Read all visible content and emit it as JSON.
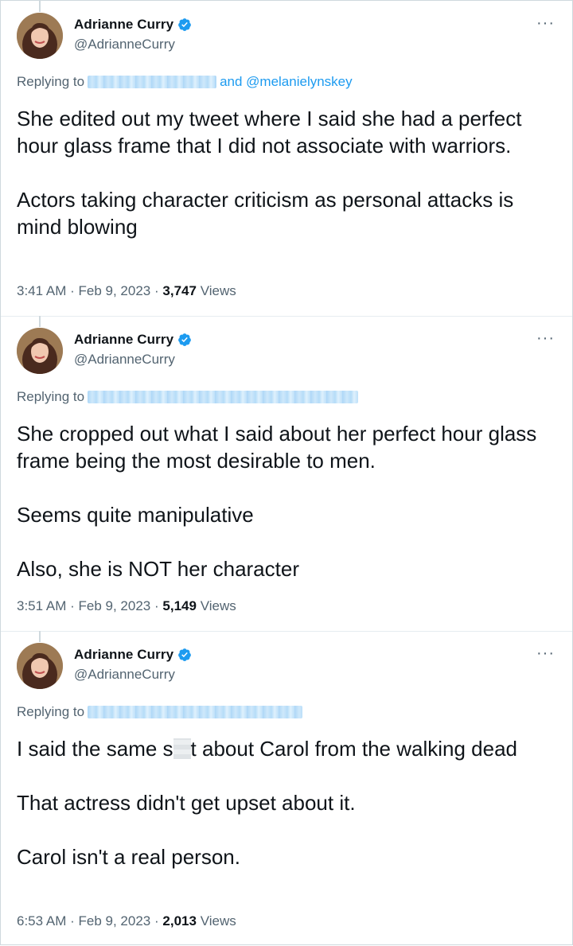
{
  "tweets": [
    {
      "name": "Adrianne Curry",
      "handle": "@AdrianneCurry",
      "more": "···",
      "replying_prefix": "Replying to",
      "replying_mention": "and @melanielynskey",
      "body": [
        "She edited out my tweet where I said she had a perfect hour glass frame that I did not associate with warriors.",
        "Actors taking character criticism as personal attacks is mind blowing"
      ],
      "time": "3:41 AM",
      "date": "Feb 9, 2023",
      "views_count": "3,747",
      "views_label": "Views"
    },
    {
      "name": "Adrianne Curry",
      "handle": "@AdrianneCurry",
      "more": "···",
      "replying_prefix": "Replying to",
      "body": [
        "She cropped out what I said about her perfect hour glass frame being the most desirable to men.",
        "Seems quite manipulative",
        "Also, she is NOT her character"
      ],
      "time": "3:51 AM",
      "date": "Feb 9, 2023",
      "views_count": "5,149",
      "views_label": "Views"
    },
    {
      "name": "Adrianne Curry",
      "handle": "@AdrianneCurry",
      "more": "···",
      "replying_prefix": "Replying to",
      "body_line1_a": "I said the same s",
      "body_line1_b": "t about Carol from the walking dead",
      "body": [
        "That actress didn't get upset about it.",
        "Carol isn't a real person."
      ],
      "time": "6:53 AM",
      "date": "Feb 9, 2023",
      "views_count": "2,013",
      "views_label": "Views"
    }
  ],
  "separator": "·",
  "colors": {
    "accent": "#1d9bf0",
    "secondary_text": "#536471",
    "primary_text": "#0f1419",
    "border": "#cfd9de"
  },
  "icons": {
    "verified": "verified-badge-icon",
    "more": "more-options-icon"
  }
}
